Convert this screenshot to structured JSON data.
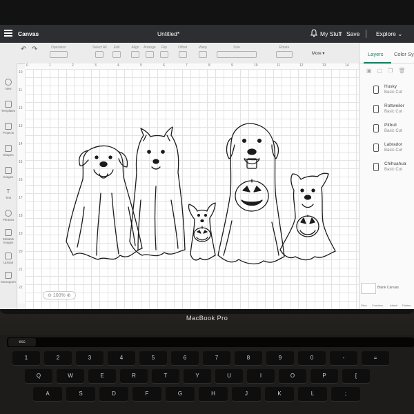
{
  "app": {
    "name": "Canvas",
    "document_title": "Untitled*"
  },
  "topbar": {
    "my_stuff": "My Stuff",
    "save": "Save",
    "explore": "Explore"
  },
  "toolbar": {
    "items": [
      {
        "label": "Undo"
      },
      {
        "label": "Redo"
      },
      {
        "label": "Operation"
      },
      {
        "label": "Select All"
      },
      {
        "label": "Edit"
      },
      {
        "label": "Align"
      },
      {
        "label": "Arrange"
      },
      {
        "label": "Flip"
      },
      {
        "label": "Offset"
      },
      {
        "label": "Warp"
      },
      {
        "label": "Size"
      },
      {
        "label": "Rotate"
      },
      {
        "label": "More"
      }
    ]
  },
  "leftnav": {
    "items": [
      {
        "label": "New"
      },
      {
        "label": "Templates"
      },
      {
        "label": "Projects"
      },
      {
        "label": "Shapes"
      },
      {
        "label": "Images"
      },
      {
        "label": "Text"
      },
      {
        "label": "Phrases"
      },
      {
        "label": "Editable Images"
      },
      {
        "label": "Upload"
      },
      {
        "label": "Monogram"
      }
    ]
  },
  "ruler": {
    "top": [
      "0",
      "1",
      "2",
      "3",
      "4",
      "5",
      "6",
      "7",
      "8",
      "9",
      "10",
      "11",
      "12",
      "13",
      "14"
    ],
    "left": [
      "10",
      "11",
      "12",
      "13",
      "14",
      "15",
      "16",
      "17",
      "18",
      "19",
      "20",
      "21",
      "22"
    ]
  },
  "canvas": {
    "zoom": "100%"
  },
  "panel": {
    "tabs": [
      {
        "label": "Layers"
      },
      {
        "label": "Color Sync"
      }
    ],
    "layers": [
      {
        "name": "Husky",
        "operation": "Basic Cut"
      },
      {
        "name": "Rottweiler",
        "operation": "Basic Cut"
      },
      {
        "name": "Pitbull",
        "operation": "Basic Cut"
      },
      {
        "name": "Labrador",
        "operation": "Basic Cut"
      },
      {
        "name": "Chihuahua",
        "operation": "Basic Cut"
      }
    ],
    "blank_canvas": "Blank Canvas",
    "actions": [
      {
        "label": "Slice"
      },
      {
        "label": "Combine"
      },
      {
        "label": "Attach"
      },
      {
        "label": "Flatten"
      }
    ]
  },
  "device": {
    "label": "MacBook Pro"
  },
  "keyboard": {
    "touchbar_esc": "esc",
    "row1": [
      "!\n1",
      "@\n2",
      "#\n3",
      "$\n4",
      "%\n5",
      "^\n6",
      "&\n7",
      "*\n8",
      "(\n9",
      ")\n0",
      "_\n-",
      "+\n="
    ],
    "row2": [
      "Q",
      "W",
      "E",
      "R",
      "T",
      "Y",
      "U",
      "I",
      "O",
      "P",
      "{\n["
    ],
    "row3": [
      "A",
      "S",
      "D",
      "F",
      "G",
      "H",
      "J",
      "K",
      "L",
      ":\n;"
    ]
  },
  "colors": {
    "accent": "#1a7f64",
    "topbar": "#2d2e31",
    "line_art": "#1b1b1b"
  }
}
